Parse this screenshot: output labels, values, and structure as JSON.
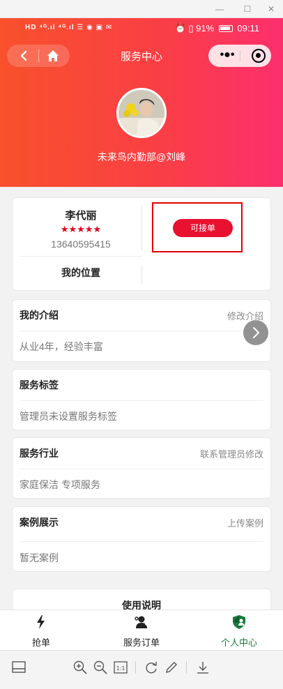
{
  "window": {
    "minimize": "—",
    "maximize": "☐",
    "close": "✕"
  },
  "status_bar": {
    "left": "HD ⁴ᴳ.ıl ⁴ᴳ.ıl ☰ ◉ ▣ ✉",
    "battery": "91%",
    "time": "09:11"
  },
  "nav": {
    "title": "服务中心"
  },
  "profile": {
    "username": "未来鸟内勤部@刘峰"
  },
  "worker": {
    "name": "李代丽",
    "stars": "★★★★★",
    "rating": 5,
    "phone": "13640595415",
    "accept_label": "可接单",
    "location_label": "我的位置"
  },
  "sections": {
    "intro": {
      "title": "我的介绍",
      "action": "修改介绍",
      "body": "从业4年，经验丰富"
    },
    "tags": {
      "title": "服务标签",
      "body": "管理员未设置服务标签"
    },
    "industry": {
      "title": "服务行业",
      "action": "联系管理员修改",
      "body": "家庭保洁 专项服务"
    },
    "cases": {
      "title": "案例展示",
      "action": "上传案例",
      "body": "暂无案例"
    },
    "usage": {
      "title": "使用说明"
    }
  },
  "tabbar": {
    "tabs": [
      {
        "label": "抢单",
        "icon": "lightning-icon",
        "active": false
      },
      {
        "label": "服务订单",
        "icon": "order-person-icon",
        "active": false
      },
      {
        "label": "个人中心",
        "icon": "shield-user-icon",
        "active": true
      }
    ],
    "active_color": "#1a7a3c"
  },
  "colors": {
    "hero_start": "#f8512c",
    "hero_end": "#fc2f6d",
    "accent_red": "#e8112f"
  }
}
